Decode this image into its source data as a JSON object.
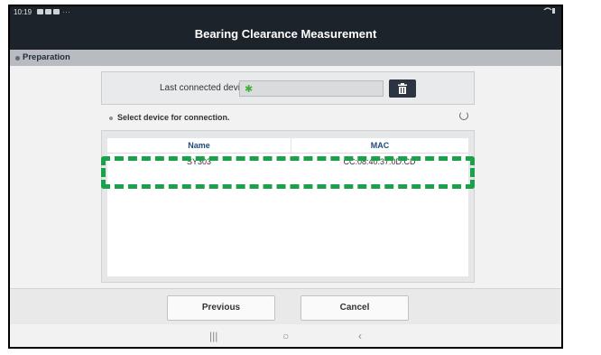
{
  "status_bar": {
    "time": "10:19",
    "dots": "···"
  },
  "header": {
    "title": "Bearing Clearance Measurement"
  },
  "section": {
    "label": "Preparation"
  },
  "last_device": {
    "label": "Last connected device",
    "value": "",
    "bt_icon": "bluetooth-icon",
    "delete_icon": "trash-icon"
  },
  "select_prompt": "Select device for connection.",
  "table": {
    "columns": [
      "Name",
      "MAC"
    ],
    "rows": [
      {
        "name": "SY303",
        "mac": "CC:08:40:37:0D:CD"
      }
    ]
  },
  "buttons": {
    "previous": "Previous",
    "cancel": "Cancel"
  },
  "nav": {
    "recent": "|||",
    "home": "○",
    "back": "‹"
  },
  "colors": {
    "highlight": "#1aa24a",
    "header_bg": "#1d232b",
    "section_bg": "#b8bbbf"
  }
}
